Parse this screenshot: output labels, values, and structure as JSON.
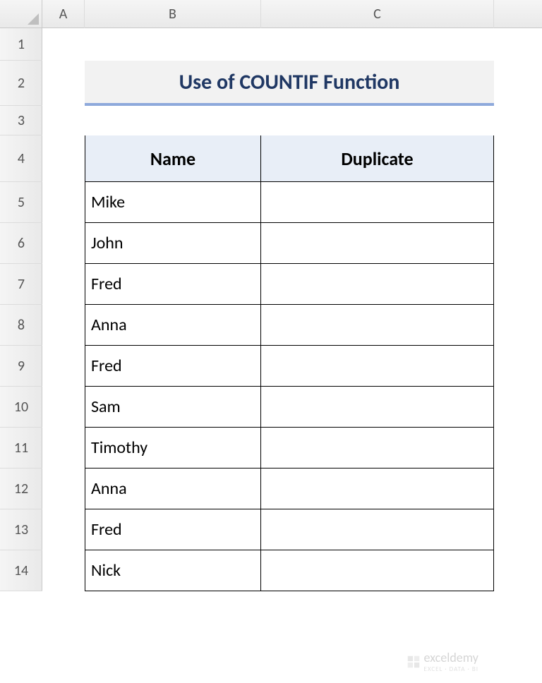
{
  "columns": [
    "A",
    "B",
    "C"
  ],
  "rows": [
    "1",
    "2",
    "3",
    "4",
    "5",
    "6",
    "7",
    "8",
    "9",
    "10",
    "11",
    "12",
    "13",
    "14"
  ],
  "title": "Use of COUNTIF Function",
  "table": {
    "headers": {
      "name": "Name",
      "duplicate": "Duplicate"
    },
    "data": [
      {
        "name": "Mike",
        "duplicate": ""
      },
      {
        "name": "John",
        "duplicate": ""
      },
      {
        "name": "Fred",
        "duplicate": ""
      },
      {
        "name": "Anna",
        "duplicate": ""
      },
      {
        "name": "Fred",
        "duplicate": ""
      },
      {
        "name": "Sam",
        "duplicate": ""
      },
      {
        "name": "Timothy",
        "duplicate": ""
      },
      {
        "name": "Anna",
        "duplicate": ""
      },
      {
        "name": "Fred",
        "duplicate": ""
      },
      {
        "name": "Nick",
        "duplicate": ""
      }
    ]
  },
  "watermark": {
    "brand": "exceldemy",
    "tag": "EXCEL · DATA · BI"
  }
}
